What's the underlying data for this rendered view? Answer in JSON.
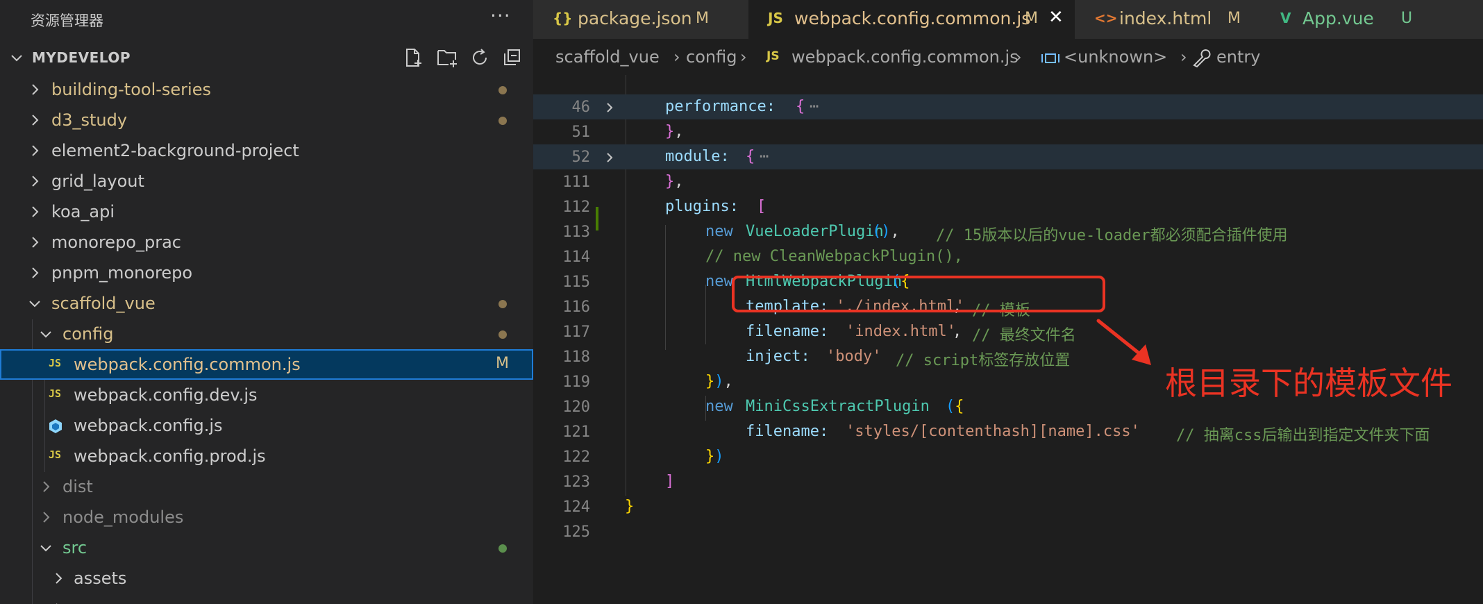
{
  "explorer": {
    "title": "资源管理器",
    "more_label": "···",
    "root": "MYDEVELOP",
    "items": [
      {
        "label": "building-tool-series",
        "color": "#d8c08a",
        "status": "dot"
      },
      {
        "label": "d3_study",
        "color": "#d8c08a",
        "status": "dot"
      },
      {
        "label": "element2-background-project",
        "color": "#cccccc"
      },
      {
        "label": "grid_layout",
        "color": "#cccccc"
      },
      {
        "label": "koa_api",
        "color": "#cccccc"
      },
      {
        "label": "monorepo_prac",
        "color": "#cccccc"
      },
      {
        "label": "pnpm_monorepo",
        "color": "#cccccc"
      },
      {
        "label": "scaffold_vue",
        "color": "#d8c08a",
        "status": "dot"
      },
      {
        "label": "config",
        "color": "#d8c08a",
        "status": "dot"
      },
      {
        "label": "webpack.config.common.js",
        "color": "#e2c08d",
        "badge": "M",
        "icon": "JS"
      },
      {
        "label": "webpack.config.dev.js",
        "color": "#cccccc",
        "icon": "JS"
      },
      {
        "label": "webpack.config.js",
        "color": "#cccccc"
      },
      {
        "label": "webpack.config.prod.js",
        "color": "#cccccc",
        "icon": "JS"
      },
      {
        "label": "dist",
        "color": "#8c8c8c"
      },
      {
        "label": "node_modules",
        "color": "#8c8c8c"
      },
      {
        "label": "src",
        "color": "#73c991",
        "status": "dot-green"
      },
      {
        "label": "assets",
        "color": "#cccccc"
      }
    ]
  },
  "tabs": [
    {
      "icon": "{}",
      "label": "package.json",
      "status": "M"
    },
    {
      "icon": "JS",
      "label": "webpack.config.common.js",
      "status": "M",
      "active": true
    },
    {
      "icon": "<>",
      "label": "index.html",
      "status": "M"
    },
    {
      "icon": "V",
      "label": "App.vue",
      "status": "U"
    }
  ],
  "close_glyph": "✕",
  "breadcrumb": {
    "parts": [
      "scaffold_vue",
      "config",
      "JS",
      "webpack.config.common.js",
      "<unknown>",
      "entry"
    ],
    "separator": "›"
  },
  "code": {
    "line_numbers": [
      "46",
      "51",
      "52",
      "111",
      "112",
      "113",
      "114",
      "115",
      "116",
      "117",
      "118",
      "119",
      "120",
      "121",
      "122",
      "123",
      "124",
      "125"
    ],
    "ellipsis": "⋯",
    "l46": "performance:",
    "l52": "module:",
    "l112": "plugins:",
    "l113_new": "new",
    "l113_cls": "VueLoaderPlugin",
    "l113_comment": "// 15版本以后的vue-loader都必须配合插件使用",
    "l114_comment": "// new CleanWebpackPlugin(),",
    "l115_new": "new",
    "l115_cls": "HtmlWebpackPlugin",
    "l116_key": "template:",
    "l116_val": "'./index.html'",
    "l116_comment": "// 模板",
    "l117_key": "filename:",
    "l117_val": "'index.html'",
    "l117_comment": "// 最终文件名",
    "l118_key": "inject:",
    "l118_val": "'body'",
    "l118_comment": "// script标签存放位置",
    "l120_new": "new",
    "l120_cls": "MiniCssExtractPlugin",
    "l121_key": "filename:",
    "l121_val": "'styles/[contenthash][name].css'",
    "l121_comment": "// 抽离css后输出到指定文件夹下面"
  },
  "annotation": {
    "text": "根目录下的模板文件",
    "color": "#ea3323"
  }
}
